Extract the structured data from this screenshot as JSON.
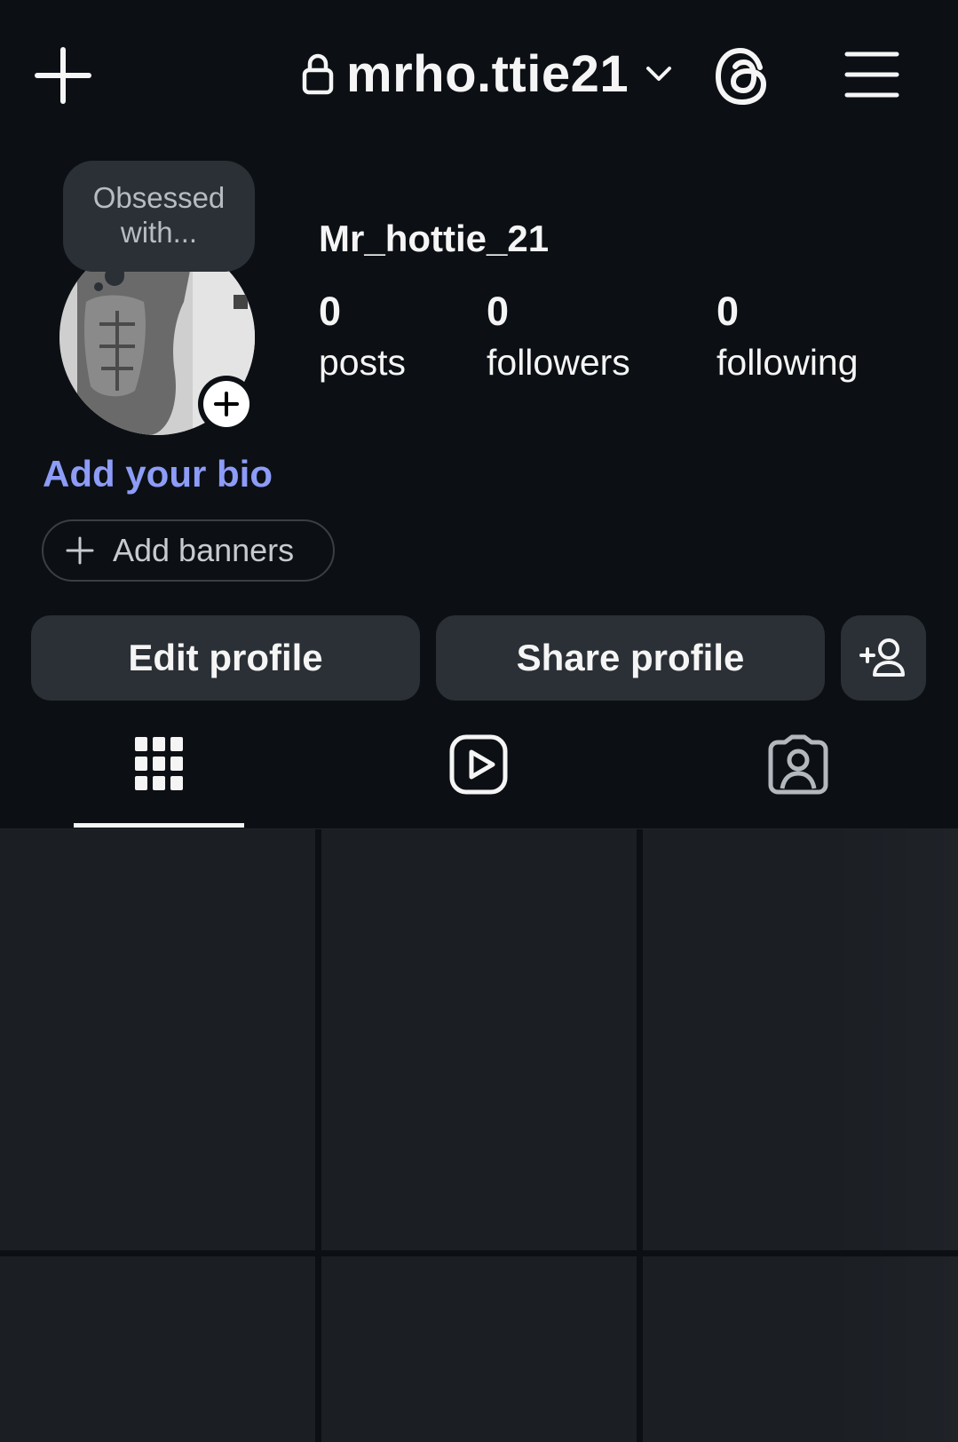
{
  "header": {
    "username": "mrho.ttie21",
    "icons": [
      "plus-icon",
      "lock-icon",
      "chevron-down-icon",
      "threads-icon",
      "menu-icon"
    ]
  },
  "note": {
    "text_line1": "Obsessed",
    "text_line2": "with..."
  },
  "profile": {
    "display_name": "Mr_hottie_21",
    "stats": [
      {
        "value": "0",
        "label": "posts"
      },
      {
        "value": "0",
        "label": "followers"
      },
      {
        "value": "0",
        "label": "following"
      }
    ],
    "bio_prompt": "Add your bio",
    "banners_label": "Add banners"
  },
  "actions": {
    "edit_label": "Edit profile",
    "share_label": "Share profile"
  },
  "tabs": [
    {
      "icon": "grid-icon",
      "active": true
    },
    {
      "icon": "reels-icon",
      "active": false
    },
    {
      "icon": "tagged-icon",
      "active": false
    }
  ],
  "colors": {
    "background": "#0c1014",
    "surface": "#2b3036",
    "link": "#8d9cf7",
    "text": "#f5f5f5"
  }
}
